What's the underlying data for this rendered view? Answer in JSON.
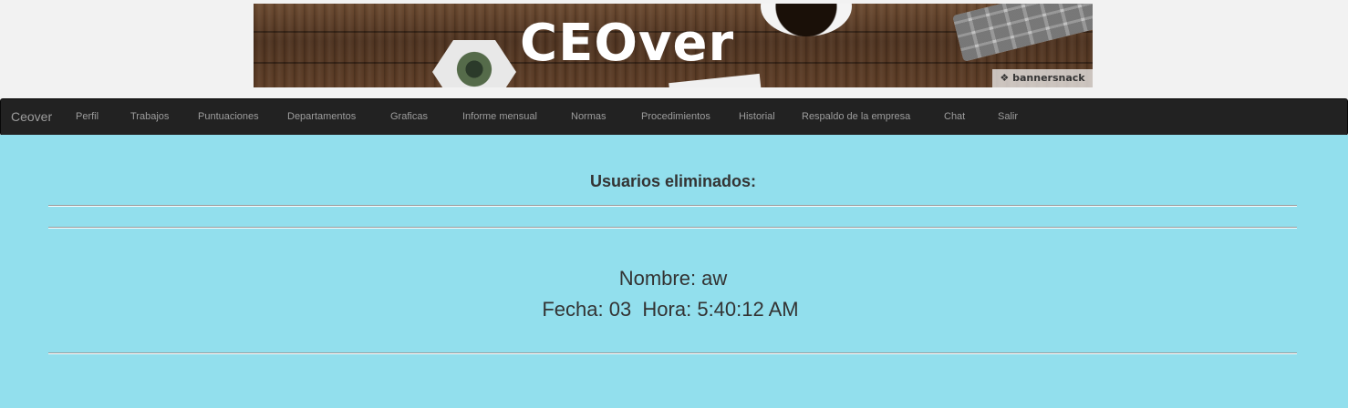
{
  "banner": {
    "logo_text": "CEOver",
    "badge_text": "bannersnack"
  },
  "navbar": {
    "brand": "Ceover",
    "items": [
      "Perfil",
      "Trabajos",
      "Puntuaciones",
      "Departamentos",
      "Graficas",
      "Informe mensual",
      "Normas",
      "Procedimientos",
      "Historial",
      "Respaldo de la empresa",
      "Chat",
      "Salir"
    ],
    "background": "#222222",
    "text_color": "#9d9d9d"
  },
  "main": {
    "heading": "Usuarios eliminados:",
    "background": "#92dfed",
    "record": {
      "name_line": "Nombre: aw",
      "date_line": "Fecha: 03  Hora: 5:40:12 AM"
    }
  }
}
